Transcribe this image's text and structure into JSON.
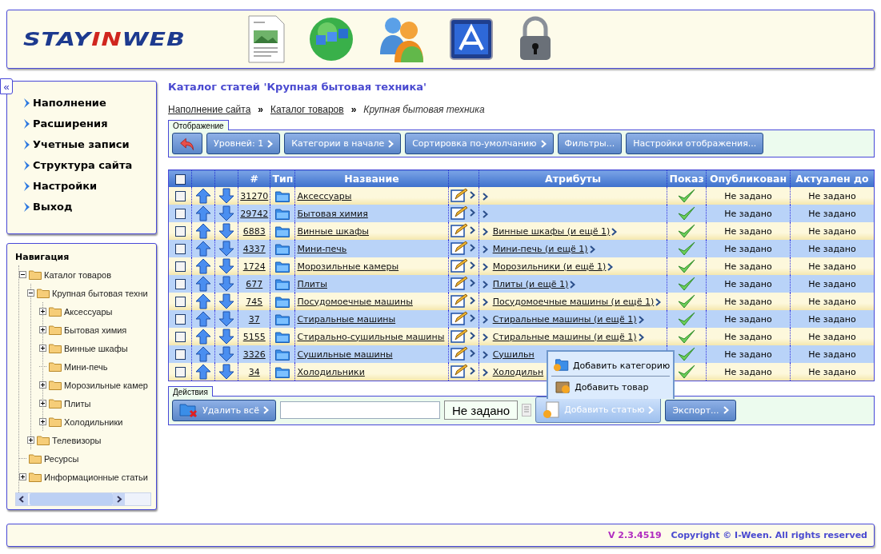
{
  "header": {
    "logo": [
      {
        "text": "STAY",
        "color": "#1d3a8f"
      },
      {
        "text": "IN",
        "color": "#d0261e"
      },
      {
        "text": "WEB",
        "color": "#1d3a8f"
      }
    ]
  },
  "sidebar": {
    "collapse_button": "«",
    "menu": [
      "Наполнение",
      "Расширения",
      "Учетные записи",
      "Структура сайта",
      "Настройки",
      "Выход"
    ],
    "navigation": {
      "title": "Навигация",
      "tree": [
        {
          "label": "Каталог товаров",
          "expanded": true,
          "children": [
            {
              "label": "Крупная бытовая техни",
              "expanded": true,
              "children": [
                {
                  "label": "Аксессуары",
                  "expanded": false
                },
                {
                  "label": "Бытовая химия",
                  "expanded": false
                },
                {
                  "label": "Винные шкафы",
                  "expanded": false
                },
                {
                  "label": "Мини-печь"
                },
                {
                  "label": "Морозильные камер",
                  "expanded": false
                },
                {
                  "label": "Плиты",
                  "expanded": false
                },
                {
                  "label": "Холодильники",
                  "expanded": false
                }
              ]
            },
            {
              "label": "Телевизоры",
              "expanded": false
            }
          ]
        },
        {
          "label": "Ресурсы"
        },
        {
          "label": "Информационные статьи",
          "expanded": false
        }
      ]
    }
  },
  "page": {
    "title": "Каталог статей 'Крупная бытовая техника'",
    "breadcrumbs": [
      {
        "kind": "link",
        "label": "Наполнение сайта"
      },
      {
        "kind": "separator",
        "label": "»"
      },
      {
        "kind": "link",
        "label": "Каталог товаров"
      },
      {
        "kind": "separator",
        "label": "»"
      },
      {
        "kind": "current",
        "label": "Крупная бытовая техника"
      }
    ],
    "display": {
      "tab": "Отображение",
      "buttons": [
        {
          "kind": "back"
        },
        {
          "kind": "menu",
          "label": "Уровней: 1"
        },
        {
          "kind": "menu",
          "label": "Категории в начале"
        },
        {
          "kind": "menu",
          "label": "Сортировка по-умолчанию"
        },
        {
          "kind": "plain",
          "label": "Фильтры..."
        },
        {
          "kind": "plain",
          "label": "Настройки отображения..."
        }
      ]
    },
    "table": {
      "select_all": {
        "checked": false
      },
      "columns": [
        "#",
        "Тип",
        "Название",
        "Атрибуты",
        "Показ",
        "Опубликован",
        "Актуален до"
      ],
      "rows": [
        {
          "checked": false,
          "id": "31270",
          "name": "Аксессуары",
          "shown": true,
          "published": "Не задано",
          "expires": "Не задано"
        },
        {
          "checked": false,
          "id": "29742",
          "name": "Бытовая химия",
          "shown": true,
          "published": "Не задано",
          "expires": "Не задано"
        },
        {
          "checked": false,
          "id": "6883",
          "name": "Винные шкафы",
          "attributes": "Винные шкафы (и ещё 1)",
          "shown": true,
          "published": "Не задано",
          "expires": "Не задано"
        },
        {
          "checked": false,
          "id": "4337",
          "name": "Мини-печь",
          "attributes": "Мини-печь (и ещё 1)",
          "shown": true,
          "published": "Не задано",
          "expires": "Не задано"
        },
        {
          "checked": false,
          "id": "1724",
          "name": "Морозильные камеры",
          "attributes": "Морозильники (и ещё 1)",
          "shown": true,
          "published": "Не задано",
          "expires": "Не задано"
        },
        {
          "checked": false,
          "id": "677",
          "name": "Плиты",
          "attributes": "Плиты (и ещё 1)",
          "shown": true,
          "published": "Не задано",
          "expires": "Не задано"
        },
        {
          "checked": false,
          "id": "745",
          "name": "Посудомоечные машины",
          "attributes": "Посудомоечные машины (и ещё 1)",
          "shown": true,
          "published": "Не задано",
          "expires": "Не задано"
        },
        {
          "checked": false,
          "id": "37",
          "name": "Стиральные машины",
          "attributes": "Стиральные машины (и ещё 1)",
          "shown": true,
          "published": "Не задано",
          "expires": "Не задано"
        },
        {
          "checked": false,
          "id": "5155",
          "name": "Стирально-сушильные машины",
          "attributes": "Стиральные машины (и ещё 1)",
          "shown": true,
          "published": "Не задано",
          "expires": "Не задано"
        },
        {
          "checked": false,
          "id": "3326",
          "name": "Сушильные машины",
          "attributes": "Сушильн",
          "attributes_cut": true,
          "shown": true,
          "published": "Не задано",
          "expires": "Не задано"
        },
        {
          "checked": false,
          "id": "34",
          "name": "Холодильники",
          "attributes": "Холодильн",
          "attributes_cut": true,
          "shown": true,
          "published": "Не задано",
          "expires": "Не задано"
        }
      ]
    },
    "actions": {
      "tab": "Действия",
      "delete_button": "Удалить всё",
      "date_field": "Не задано",
      "add_article_button": "Добавить статью",
      "export_button": "Экспорт...",
      "popup_menu": [
        {
          "kind": "category",
          "label": "Добавить категорию"
        },
        {
          "kind": "product",
          "label": "Добавить товар"
        }
      ]
    }
  },
  "footer": {
    "version": "V 2.3.4519",
    "copyright": "Copyright © I-Ween. All rights reserved"
  }
}
